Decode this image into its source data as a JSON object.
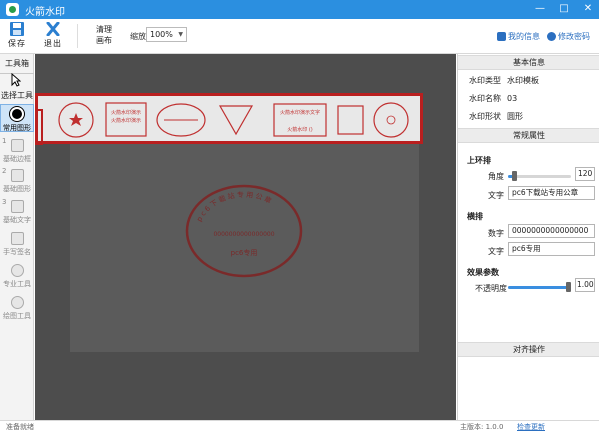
{
  "app": {
    "title": "火箭水印"
  },
  "toolbar": {
    "save_label": "保存",
    "exit_label": "退出",
    "clear_canvas_label": [
      "清理",
      "画布"
    ],
    "zoom_label": "缩放",
    "zoom_value": "100%",
    "my_info_label": "我的信息",
    "change_password_label": "修改密码"
  },
  "left_panel": {
    "header": "工具箱",
    "select_tool_label": "选择工具",
    "tools": [
      {
        "num": "",
        "label": "常用图形"
      },
      {
        "num": "1",
        "label": "基础边框"
      },
      {
        "num": "2",
        "label": "基础图形"
      },
      {
        "num": "3",
        "label": "基础文字"
      },
      {
        "num": "",
        "label": "手写签名"
      },
      {
        "num": "",
        "label": "专业工具"
      },
      {
        "num": "",
        "label": "绘图工具"
      }
    ]
  },
  "canvas": {
    "stamp_preview": {
      "top_text": "pc6下载站专用公章",
      "middle_text": "0000000000000000",
      "bottom_text": "pc6专用"
    },
    "strip_stamps": [
      "火箭水印演示",
      "火箭水印演示",
      "火箭水印演示文字",
      "火箭水印 ()"
    ]
  },
  "right_panel": {
    "basic_info_header": "基本信息",
    "watermark_type_label": "水印类型",
    "watermark_type_value": "水印模板",
    "watermark_name_label": "水印名称",
    "watermark_name_value": "03",
    "watermark_shape_label": "水印形状",
    "watermark_shape_value": "圆形",
    "general_props_header": "常规属性",
    "upper_ring_label": "上环排",
    "angle_label": "角度",
    "angle_value": "120",
    "angle_fraction": 0.1,
    "text_label": "文字",
    "upper_text_value": "pc6下载站专用公章",
    "horizontal_label": "横排",
    "number_label": "数字",
    "number_value": "0000000000000000",
    "horizontal_text_label": "文字",
    "horizontal_text_value": "pc6专用",
    "effect_label": "效果参数",
    "opacity_label": "不透明度",
    "opacity_value": "1.00",
    "opacity_fraction": 1.0,
    "align_header": "对齐操作"
  },
  "status": {
    "left_text": "准备就绪",
    "version_text": "主版本: 1.0.0",
    "check_update_label": "检查更新"
  },
  "colors": {
    "titlebar": "#2b8fe0",
    "stamp_red": "#b91f1f",
    "canvas_dark": "#4d4d4d",
    "link_blue": "#2b6fc0"
  }
}
